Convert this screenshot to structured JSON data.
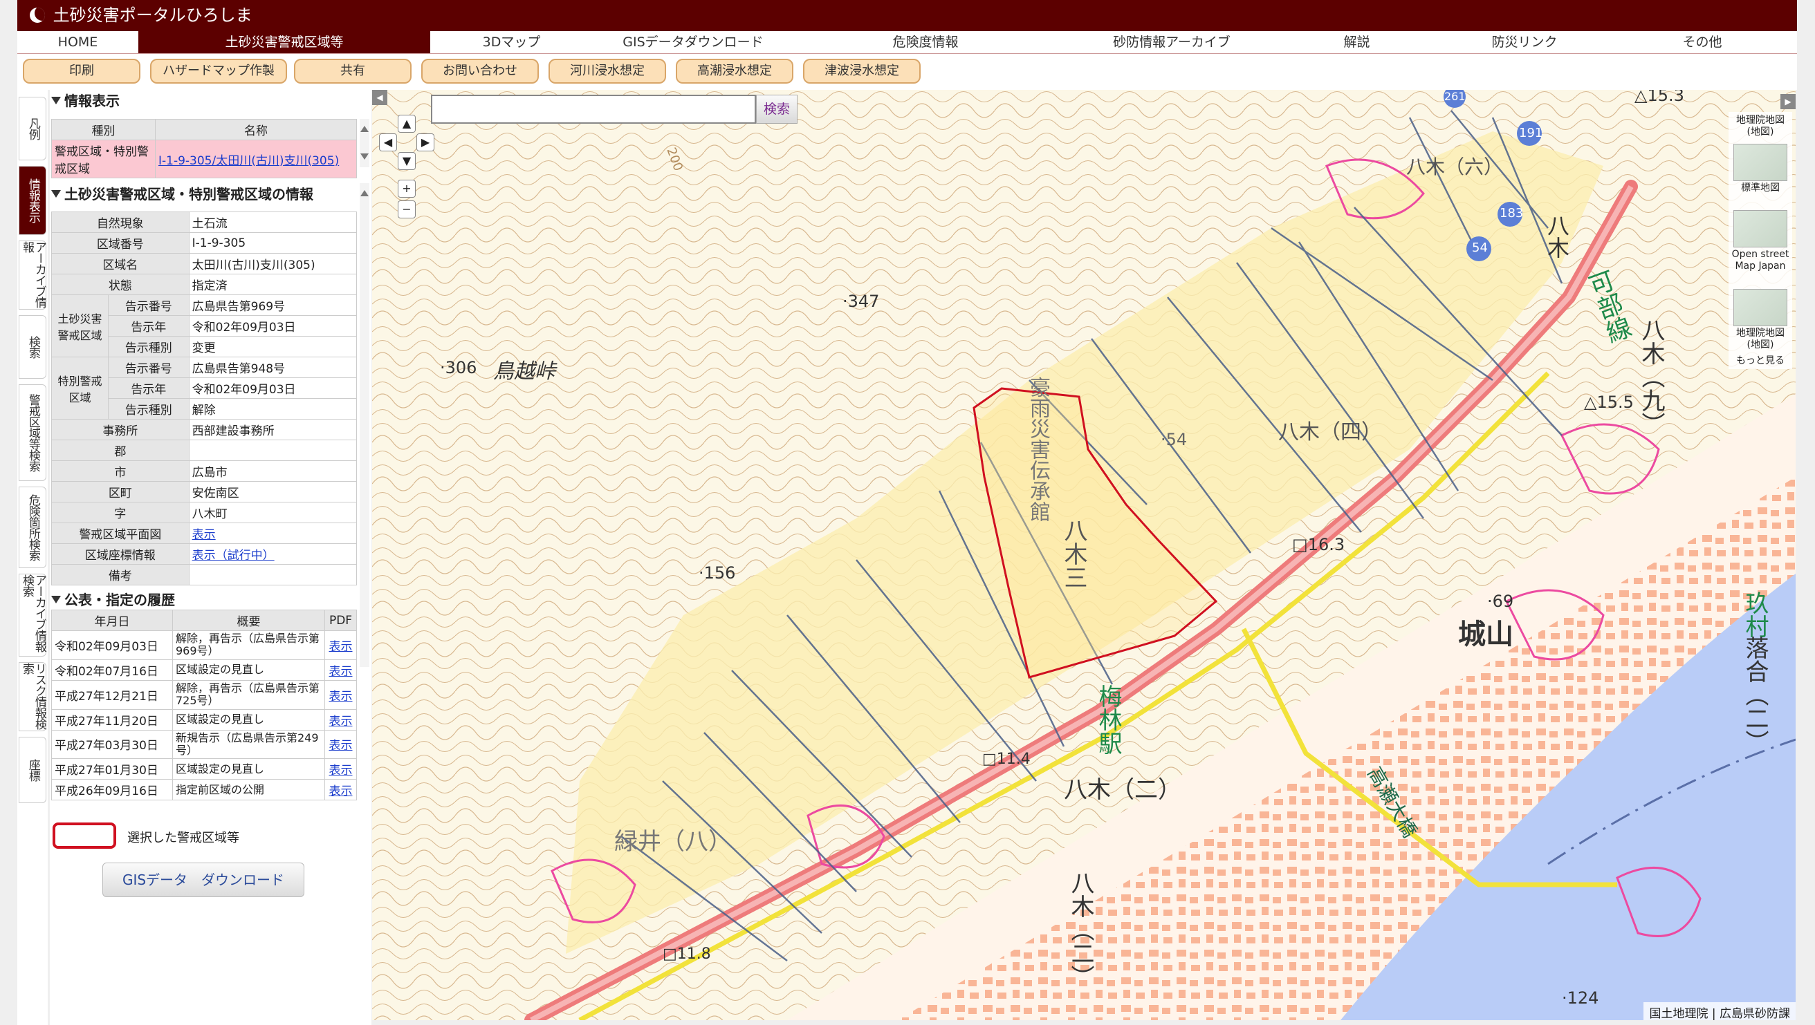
{
  "header": {
    "title": "土砂災害ポータルひろしま"
  },
  "nav": [
    {
      "label": "HOME",
      "active": false
    },
    {
      "label": "土砂災害警戒区域等",
      "active": true
    },
    {
      "label": "3Dマップ",
      "active": false
    },
    {
      "label": "GISデータダウンロード",
      "active": false
    },
    {
      "label": "危険度情報",
      "active": false
    },
    {
      "label": "砂防情報アーカイブ",
      "active": false
    },
    {
      "label": "解説",
      "active": false
    },
    {
      "label": "防災リンク",
      "active": false
    },
    {
      "label": "その他",
      "active": false
    }
  ],
  "toolbar": [
    "印刷",
    "ハザードマップ作製",
    "共有",
    "お問い合わせ",
    "河川浸水想定",
    "高潮浸水想定",
    "津波浸水想定"
  ],
  "vtabs": [
    "凡例",
    "情報表示",
    "アーカイブ情報",
    "検索",
    "警戒区域等検索",
    "危険箇所検索",
    "アーカイブ情報検索",
    "リスク情報検索",
    "座標"
  ],
  "info": {
    "title": "情報表示",
    "col_kind": "種別",
    "col_name": "名称",
    "row_kind": "警戒区域・特別警戒区域",
    "row_name": "Ⅰ-1-9-305/太田川(古川)支川(305)"
  },
  "detail": {
    "title": "土砂災害警戒区域・特別警戒区域の情報",
    "natural_label": "自然現象",
    "natural": "土石流",
    "area_no_label": "区域番号",
    "area_no": "Ⅰ-1-9-305",
    "area_name_label": "区域名",
    "area_name": "太田川(古川)支川(305)",
    "state_label": "状態",
    "state": "指定済",
    "warn_group": "土砂災害警戒区域",
    "warn_notice_label": "告示番号",
    "warn_notice": "広島県告第969号",
    "warn_year_label": "告示年",
    "warn_year": "令和02年09月03日",
    "warn_kind_label": "告示種別",
    "warn_kind": "変更",
    "special_group": "特別警戒区域",
    "sp_notice_label": "告示番号",
    "sp_notice": "広島県告第948号",
    "sp_year_label": "告示年",
    "sp_year": "令和02年09月03日",
    "sp_kind_label": "告示種別",
    "sp_kind": "解除",
    "office_label": "事務所",
    "office": "西部建設事務所",
    "county_label": "郡",
    "county": "",
    "city_label": "市",
    "city": "広島市",
    "ward_label": "区町",
    "ward": "安佐南区",
    "aza_label": "字",
    "aza": "八木町",
    "plan_label": "警戒区域平面図",
    "plan": "表示",
    "coord_label": "区域座標情報",
    "coord": "表示（試行中）",
    "note_label": "備考",
    "note": ""
  },
  "history": {
    "title": "公表・指定の履歴",
    "headers": [
      "年月日",
      "概要",
      "PDF"
    ],
    "rows": [
      {
        "date": "令和02年09月03日",
        "desc": "解除，再告示（広島県告示第969号）",
        "pdf": "表示"
      },
      {
        "date": "令和02年07月16日",
        "desc": "区域設定の見直し",
        "pdf": "表示"
      },
      {
        "date": "平成27年12月21日",
        "desc": "解除，再告示（広島県告示第725号）",
        "pdf": "表示"
      },
      {
        "date": "平成27年11月20日",
        "desc": "区域設定の見直し",
        "pdf": "表示"
      },
      {
        "date": "平成27年03月30日",
        "desc": "新規告示（広島県告示第249号）",
        "pdf": "表示"
      },
      {
        "date": "平成27年01月30日",
        "desc": "区域設定の見直し",
        "pdf": "表示"
      },
      {
        "date": "平成26年09月16日",
        "desc": "指定前区域の公開",
        "pdf": "表示"
      }
    ]
  },
  "legend_selected": "選択した警戒区域等",
  "gis_button": "GISデータ　ダウンロード",
  "map": {
    "search_placeholder": "",
    "search_button": "検索",
    "basemaps": [
      "地理院地図(地図)",
      "標準地図",
      "Open street Map Japan",
      "地理院地図(地図)",
      "もっと見る"
    ],
    "attribution": "国土地理院 | 広島県砂防課",
    "labels": {
      "pass": "鳥越峠",
      "memorial": "豪雨災害伝承館",
      "station": "梅林駅",
      "castle": "城山",
      "bridge": "高瀬大橋",
      "line": "可部線",
      "yagi4": "八木（四）",
      "yagi3": "八木三",
      "yagi2": "八木（二）",
      "yagi9": "八木（九）",
      "yagi6": "八木（六）",
      "yagi_a": "八木",
      "yagi_b": "八木（二）",
      "midorii": "緑井（八）",
      "kumanmoto": "玖村",
      "ochiai": "落合（二）",
      "e347": "347",
      "e306": "306",
      "e156": "156",
      "e54": "54",
      "e163": "16.3",
      "e69": "69",
      "e114": "11.4",
      "e118": "11.8",
      "e124": "124",
      "e155": "15.5",
      "e153": "15.3",
      "r191": "191",
      "r183": "183",
      "r54": "54",
      "r261": "261",
      "r200": "200"
    }
  }
}
